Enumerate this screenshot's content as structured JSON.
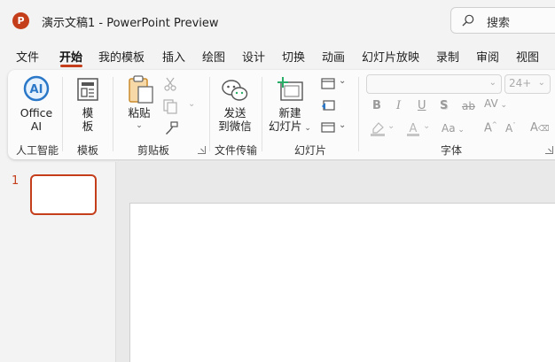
{
  "app": {
    "title": "演示文稿1  -  PowerPoint Preview",
    "logo_letter": "P",
    "search_placeholder": "搜索",
    "accent_color": "#c43e1c"
  },
  "tabs": [
    {
      "label": "文件"
    },
    {
      "label": "开始",
      "active": true
    },
    {
      "label": "我的模板"
    },
    {
      "label": "插入"
    },
    {
      "label": "绘图"
    },
    {
      "label": "设计"
    },
    {
      "label": "切换"
    },
    {
      "label": "动画"
    },
    {
      "label": "幻灯片放映"
    },
    {
      "label": "录制"
    },
    {
      "label": "审阅"
    },
    {
      "label": "视图"
    }
  ],
  "ribbon": {
    "ai": {
      "button_line1": "Office",
      "button_line2": "AI",
      "group": "人工智能",
      "icon_text": "AI"
    },
    "template": {
      "button_line1": "模",
      "button_line2": "板",
      "group": "模板"
    },
    "clipboard": {
      "paste_label": "粘贴",
      "group": "剪贴板"
    },
    "file_transfer": {
      "button_line1": "发送",
      "button_line2": "到微信",
      "group": "文件传输"
    },
    "slides": {
      "new_line1": "新建",
      "new_line2": "幻灯片",
      "group": "幻灯片"
    },
    "font": {
      "font_name": "",
      "font_size": "24+",
      "group": "字体",
      "bold": "B",
      "italic": "I",
      "underline": "U",
      "shadow": "S",
      "strike": "ab",
      "spacing": "AV",
      "case": "Aa",
      "grow": "A",
      "shrink": "A",
      "clear": "A"
    }
  },
  "slides_pane": {
    "items": [
      {
        "number": "1"
      }
    ]
  }
}
